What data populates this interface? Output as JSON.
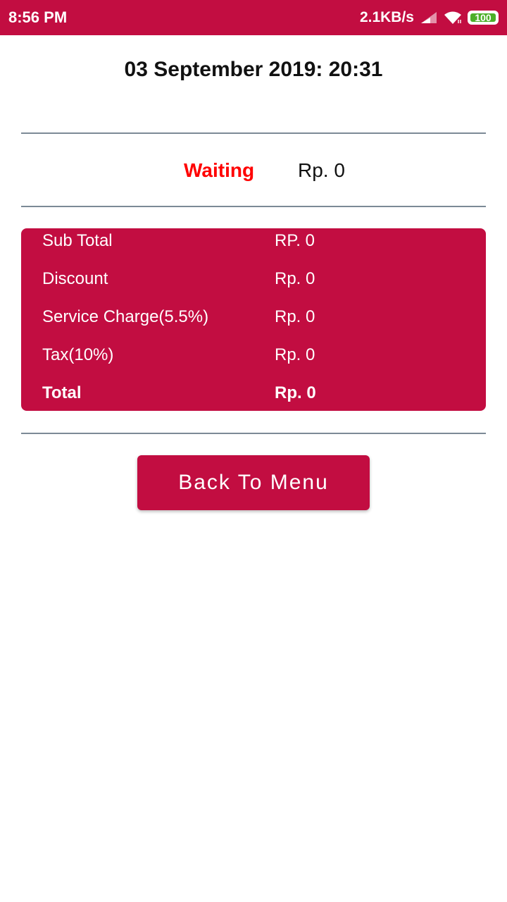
{
  "status_bar": {
    "time": "8:56 PM",
    "net_speed": "2.1KB/s",
    "battery_level": "100",
    "battery_fraction": 1.0,
    "signal_icon": "signal-icon",
    "wifi_icon": "wifi-icon",
    "background_color": "#c20d41"
  },
  "order": {
    "datetime": "03 September 2019: 20:31",
    "status": "Waiting",
    "status_color": "#ff0000",
    "amount": "Rp. 0"
  },
  "summary": {
    "background_color": "#c20d41",
    "rows": [
      {
        "label": "Sub Total",
        "value": "RP. 0"
      },
      {
        "label": "Discount",
        "value": "Rp. 0"
      },
      {
        "label": "Service Charge(5.5%)",
        "value": "Rp. 0"
      },
      {
        "label": "Tax(10%)",
        "value": "Rp. 0"
      },
      {
        "label": "Total",
        "value": "Rp. 0"
      }
    ]
  },
  "actions": {
    "back_label": "Back To Menu"
  }
}
